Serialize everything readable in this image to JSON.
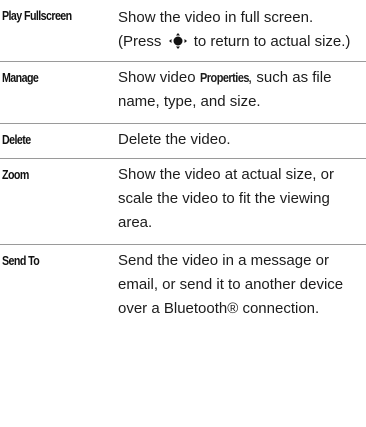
{
  "rows": [
    {
      "command": "Play Fullscreen",
      "desc_before": "Show the video in full screen. (Press",
      "icon": "nav-key-icon",
      "desc_after": "to return to actual size.)"
    },
    {
      "command": "Manage",
      "desc_before": "Show video",
      "inline_bold": "Properties",
      "desc_after": ", such as file name, type, and size."
    },
    {
      "command": "Delete",
      "desc": "Delete the video."
    },
    {
      "command": "Zoom",
      "desc": "Show the video at actual size, or scale the video to fit the viewing area."
    },
    {
      "command": "Send To",
      "desc": "Send the video in a message or email, or send it to another device over a Bluetooth® connection."
    }
  ]
}
